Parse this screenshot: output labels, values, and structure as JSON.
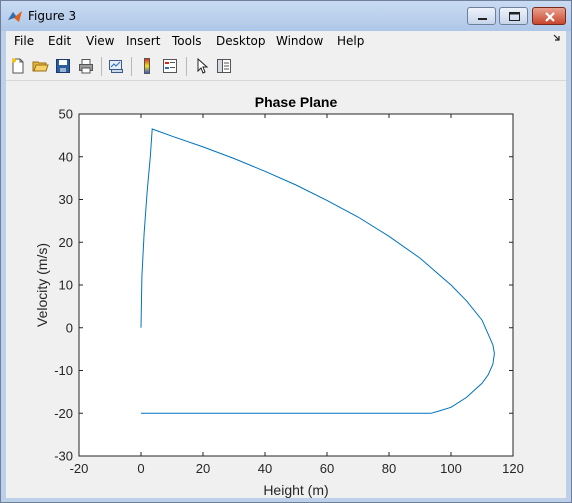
{
  "window": {
    "title": "Figure 3",
    "app_icon": "matlab-icon",
    "buttons": [
      "minimize-icon",
      "maximize-icon",
      "close-icon"
    ]
  },
  "menu": {
    "items": [
      "File",
      "Edit",
      "View",
      "Insert",
      "Tools",
      "Desktop",
      "Window",
      "Help"
    ],
    "dock_icon": "dock-arrow-icon"
  },
  "toolbar": {
    "icons": [
      "new-figure-icon",
      "open-file-icon",
      "save-icon",
      "print-icon",
      "link-plot-icon",
      "colorbar-icon",
      "legend-icon",
      "edit-plot-icon",
      "property-editor-icon"
    ]
  },
  "colors": {
    "line": "#0072bd",
    "axes_bg": "#ffffff",
    "figure_bg": "#f0f0f0"
  },
  "chart_data": {
    "type": "line",
    "title": "Phase Plane",
    "xlabel": "Height (m)",
    "ylabel": "Velocity (m/s)",
    "xlim": [
      -20,
      120
    ],
    "ylim": [
      -30,
      50
    ],
    "xticks": [
      "-20",
      "0",
      "20",
      "40",
      "60",
      "80",
      "100",
      "120"
    ],
    "yticks": [
      "-30",
      "-20",
      "-10",
      "0",
      "10",
      "20",
      "30",
      "40",
      "50"
    ],
    "grid": false,
    "series": [
      {
        "x": [
          0,
          0.3,
          1.0,
          2.0,
          3.0,
          3.6,
          10,
          20,
          30,
          40,
          50,
          60,
          70,
          80,
          90,
          100,
          105,
          110,
          112,
          113.5,
          114,
          113.5,
          112,
          110,
          105,
          100,
          96,
          93.5,
          80,
          60,
          40,
          20,
          0
        ],
        "y": [
          0,
          12,
          22,
          32,
          40,
          46.5,
          44.8,
          42.3,
          39.6,
          36.6,
          33.4,
          29.8,
          25.9,
          21.4,
          16.3,
          10.0,
          6.3,
          1.8,
          -1.5,
          -4.0,
          -6.0,
          -8.5,
          -11.0,
          -13.0,
          -16.3,
          -18.6,
          -19.5,
          -20,
          -20,
          -20,
          -20,
          -20,
          -20
        ]
      }
    ]
  }
}
